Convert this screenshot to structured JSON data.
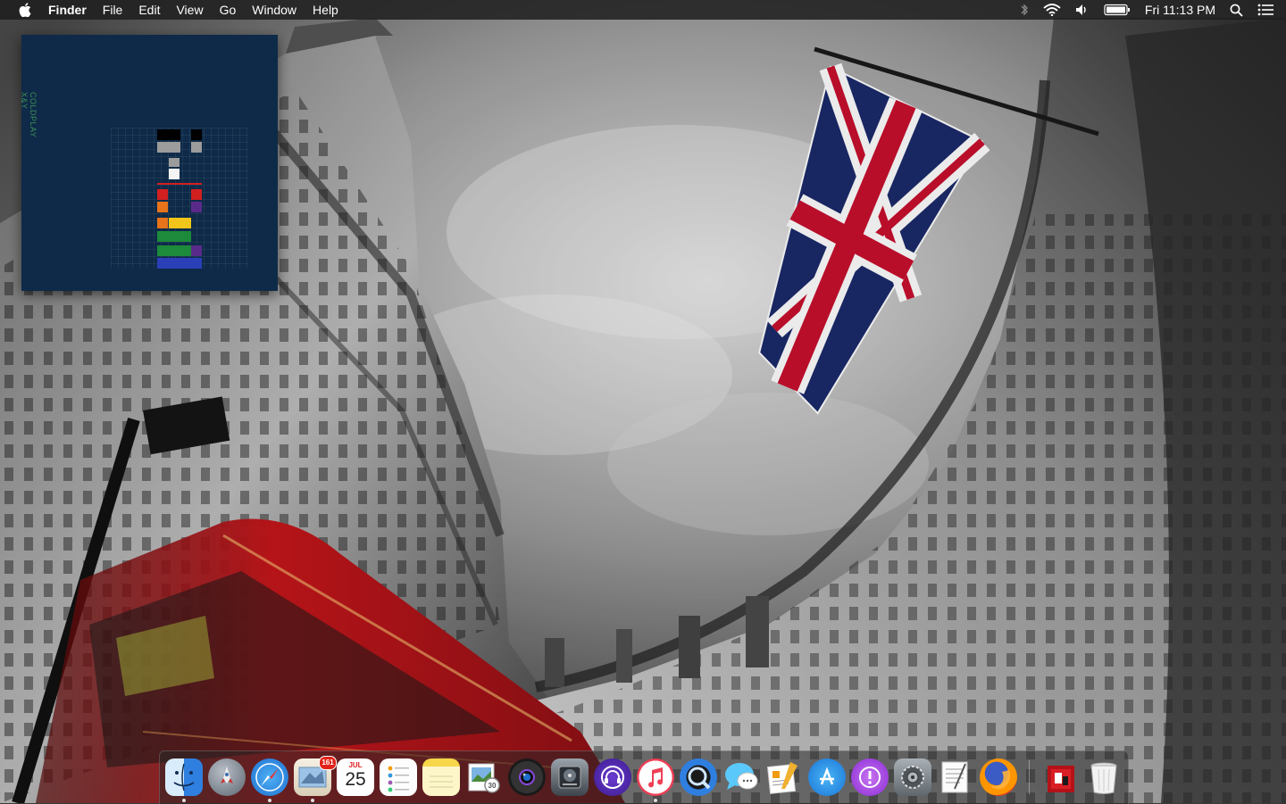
{
  "menubar": {
    "app_name": "Finder",
    "menus": [
      "File",
      "Edit",
      "View",
      "Go",
      "Window",
      "Help"
    ],
    "clock": "Fri 11:13 PM",
    "status_icons": [
      "bluetooth-icon",
      "wifi-icon",
      "volume-icon",
      "battery-icon",
      "spotlight-icon",
      "notification-center-icon"
    ]
  },
  "album_widget": {
    "artist": "COLDPLAY",
    "title": "X&Y",
    "colors": {
      "background": "#0e2a48",
      "black": "#000000",
      "gray": "#9c9c9c",
      "white": "#f4f4f4",
      "red": "#d21f1f",
      "orange": "#e8731a",
      "yellow": "#f2c51a",
      "green": "#1c8a3a",
      "blue": "#2a3fb8",
      "purple": "#5a2a8a"
    }
  },
  "dock": {
    "items": [
      {
        "name": "Finder",
        "icon": "finder-icon",
        "running": true
      },
      {
        "name": "Launchpad",
        "icon": "launchpad-icon",
        "running": false
      },
      {
        "name": "Safari",
        "icon": "safari-icon",
        "running": true
      },
      {
        "name": "Mail",
        "icon": "mail-icon",
        "running": true,
        "badge": "161"
      },
      {
        "name": "Calendar",
        "icon": "calendar-icon",
        "running": false,
        "month": "JUL",
        "day": "25"
      },
      {
        "name": "Reminders",
        "icon": "reminders-icon",
        "running": false
      },
      {
        "name": "Notes",
        "icon": "notes-icon",
        "running": false
      },
      {
        "name": "Preview",
        "icon": "preview-icon",
        "running": false
      },
      {
        "name": "Photo Booth",
        "icon": "photo-booth-icon",
        "running": false
      },
      {
        "name": "Disk Utility",
        "icon": "disk-utility-icon",
        "running": false
      },
      {
        "name": "Podcast App",
        "icon": "podcast-app-icon",
        "running": false
      },
      {
        "name": "iTunes",
        "icon": "itunes-icon",
        "running": true
      },
      {
        "name": "QuickTime Player",
        "icon": "quicktime-icon",
        "running": false
      },
      {
        "name": "Messages",
        "icon": "messages-icon",
        "running": false
      },
      {
        "name": "Pages",
        "icon": "pages-icon",
        "running": false
      },
      {
        "name": "App Store",
        "icon": "app-store-icon",
        "running": false
      },
      {
        "name": "Feedback Assistant",
        "icon": "feedback-icon",
        "running": false
      },
      {
        "name": "System Preferences",
        "icon": "system-preferences-icon",
        "running": false
      },
      {
        "name": "TextEdit",
        "icon": "textedit-icon",
        "running": false
      },
      {
        "name": "Firefox",
        "icon": "firefox-icon",
        "running": false
      },
      {
        "name": "Album Art",
        "icon": "album-art-icon",
        "running": false
      },
      {
        "name": "Trash",
        "icon": "trash-icon",
        "running": false
      }
    ]
  }
}
